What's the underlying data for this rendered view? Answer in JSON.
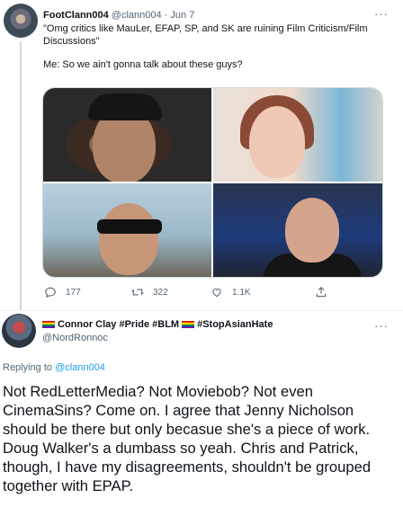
{
  "parent_tweet": {
    "name": "FootClann004",
    "handle": "@clann004",
    "time": "· Jun 7",
    "text_lines": [
      "\"Omg critics like MauLer, EFAP, SP, and SK are ruining Film Criticism/Film Discussions\"",
      "Me: So we ain't gonna talk about these guys?"
    ],
    "media": [
      "image-1",
      "image-2",
      "image-3",
      "image-4"
    ],
    "actions": {
      "reply_count": "177",
      "retweet_count": "322",
      "like_count": "1.1K"
    }
  },
  "reply_tweet": {
    "name_parts": [
      "Connor Clay #Pride #BLM",
      "#StopAsianHate"
    ],
    "handle": "@NordRonnoc",
    "replying_prefix": "Replying to",
    "replying_to": "@clann004",
    "text": "Not RedLetterMedia? Not Moviebob? Not even CinemaSins? Come on. I agree that Jenny Nicholson should be there but only becasue she's a piece of work. Doug Walker's a dumbass so yeah. Chris and Patrick, though, I have my disagreements, shouldn't be grouped together with EPAP."
  },
  "icons": {
    "more": "more-icon",
    "reply": "reply-icon",
    "retweet": "retweet-icon",
    "like": "like-icon",
    "share": "share-icon",
    "flag": "pride-flag-icon"
  },
  "colors": {
    "text": "#0f1419",
    "secondary": "#536471",
    "link": "#1d9bf0",
    "divider": "#eff3f4"
  }
}
